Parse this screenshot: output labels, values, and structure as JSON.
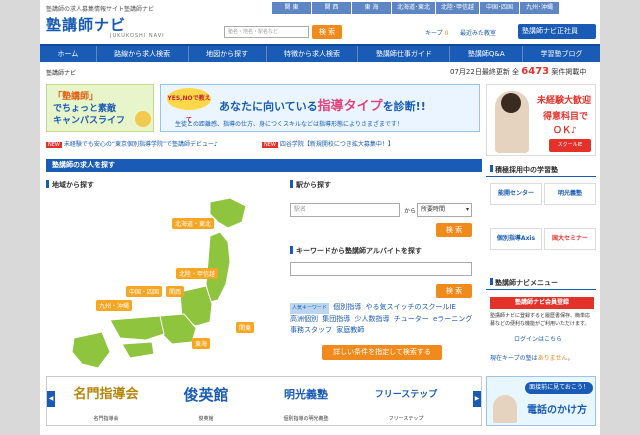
{
  "header": {
    "tagline": "塾講師の求人募集情報サイト塾講師ナビ",
    "logo": "塾講師ナビ",
    "logo_sub": "JUKUKOSHI NAVI",
    "regions": [
      "関 東",
      "関 西",
      "東 海",
      "北海道･東北",
      "北陸･甲信越",
      "中国･四国",
      "九州･沖縄"
    ],
    "search_placeholder": "塾名・地名・駅名など",
    "search_button": "検 索",
    "keep_link": "キープ",
    "keep_count": "0",
    "recent_link": "最近みた教室",
    "register_button": "塾講師ナビ正社員"
  },
  "nav": [
    "ホーム",
    "路線から求人検索",
    "地図から探す",
    "特徴から求人検索",
    "塾講師仕事ガイド",
    "塾講師Q&A",
    "学習塾ブログ"
  ],
  "breadcrumb": "塾講師ナビ",
  "update": {
    "prefix": "07月22日最終更新 全",
    "count": "6473",
    "suffix": "案件掲載中"
  },
  "banners": {
    "left": {
      "line1": "「塾講師」",
      "line2": "でちょっと素敵",
      "line3": "キャンパスライフ"
    },
    "center": {
      "bubble": "YES,NOで教えて",
      "main": "あなたに向いている",
      "highlight": "指導タイプ",
      "tail": "を診断!!",
      "sub": "生徒との距離感、指導の仕方、身につくスキルなどは指導形態によりさまざまです！"
    },
    "right": {
      "line1": "未経験大歓迎",
      "line2": "得意科目で",
      "line3": "ＯＫ♪",
      "badge": "スクールIE"
    }
  },
  "news": [
    {
      "tag": "NEW",
      "text": "未経験でも安心の“東京個別指導学院”で塾講師デビュー♪"
    },
    {
      "tag": "NEW",
      "text": "四谷学院【新規開校につき拡大募集中！】"
    }
  ],
  "job_section": {
    "title": "塾講師の求人を探す",
    "area_title": "地域から探す",
    "regions": [
      "北海道・東北",
      "北陸・甲信越",
      "中国・四国",
      "関西",
      "九州・沖縄",
      "東海",
      "関東"
    ],
    "station_title": "駅から探す",
    "station_placeholder": "駅名",
    "from_label": "から",
    "select_value": "所要時間",
    "station_button": "検 索",
    "keyword_title": "キーワードから塾講師アルバイトを探す",
    "keyword_button": "検 索",
    "popular_label": "人気キーワード",
    "keywords": [
      "個別指導",
      "やる気スイッチのスクールIE",
      "高洲個別",
      "集団指導",
      "少人数指導",
      "チューター",
      "eラーニング",
      "事務スタッフ",
      "家庭教師"
    ],
    "detail_button": "詳しい条件を指定して検索する"
  },
  "sidebar": {
    "schools_title": "積極採用中の学習塾",
    "schools": [
      "能開センター",
      "明光義塾",
      "個別指導Axis",
      "国大セミナー"
    ],
    "menu_title": "塾講師ナビメニュー",
    "menu_button": "塾講師ナビ会員登録",
    "menu_desc": "塾講師ナビに登録すると履歴書保存、簡単応募などの便利な機能がご利用いただけます。",
    "login_link": "ログインはこちら",
    "keep_note_prefix": "現在キープの塾は",
    "keep_note_count": "ありません",
    "keep_note_suffix": "。"
  },
  "bottom_logos": [
    {
      "name": "名門指導会",
      "caption": "名門指導会",
      "color": "#b8860b"
    },
    {
      "name": "俊英館",
      "caption": "俊英館",
      "color": "#1a5cb5"
    },
    {
      "name": "明光義塾",
      "caption": "個別指導の明光義塾",
      "color": "#1a5cb5"
    },
    {
      "name": "フリーステップ",
      "caption": "フリーステップ",
      "color": "#1a5cb5"
    }
  ],
  "bottom_banner": {
    "tag": "面接前に見ておこう！",
    "title": "電話のかけ方"
  },
  "colors": {
    "brand": "#1a5cb5",
    "accent": "#f08a1c",
    "alert": "#e4322b"
  }
}
